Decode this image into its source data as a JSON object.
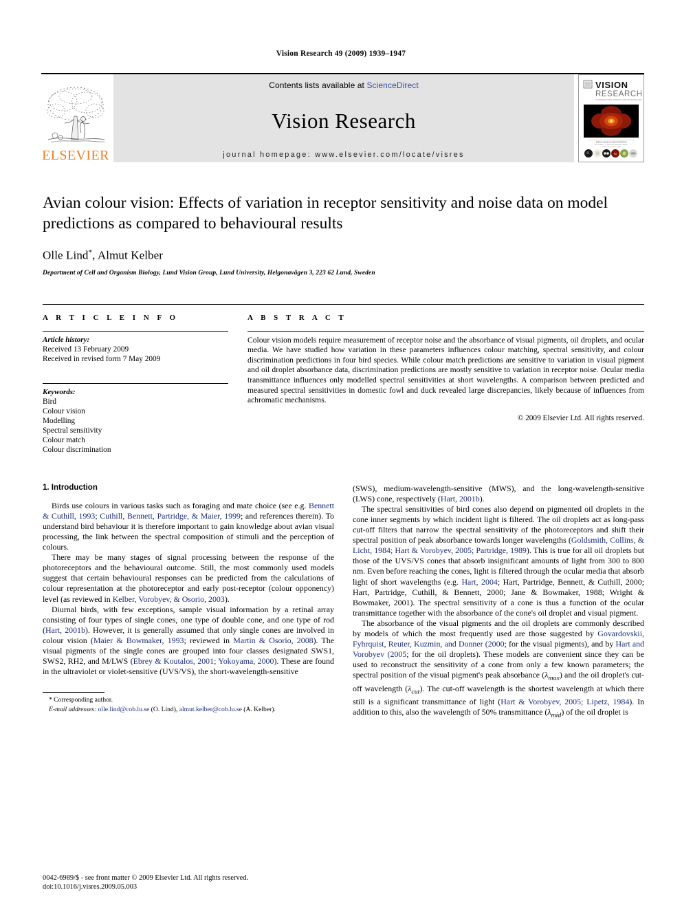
{
  "running_head": "Vision Research 49 (2009) 1939–1947",
  "masthead": {
    "publisher_name": "ELSEVIER",
    "contents_prefix": "Contents lists available at ",
    "contents_link": "ScienceDirect",
    "journal_title": "Vision Research",
    "homepage": "journal homepage: www.elsevier.com/locate/visres",
    "cover": {
      "line1": "VISION",
      "line2": "RESEARCH",
      "line3": "AN INTERNATIONAL JOURNAL FOR FUNCTIONAL ASPECTS OF VISION"
    }
  },
  "article": {
    "title": "Avian colour vision: Effects of variation in receptor sensitivity and noise data on model predictions as compared to behavioural results",
    "authors": "Olle Lind",
    "authors_rest": ", Almut Kelber",
    "corresponding_marker": "*",
    "affiliation": "Department of Cell and Organism Biology, Lund Vision Group, Lund University, Helgonavägen 3, 223 62 Lund, Sweden"
  },
  "info": {
    "heading": "A R T I C L E   I N F O",
    "history_label": "Article history:",
    "history": [
      "Received 13 February 2009",
      "Received in revised form 7 May 2009"
    ],
    "keywords_label": "Keywords:",
    "keywords": [
      "Bird",
      "Colour vision",
      "Modelling",
      "Spectral sensitivity",
      "Colour match",
      "Colour discrimination"
    ]
  },
  "abstract": {
    "heading": "A B S T R A C T",
    "text": "Colour vision models require measurement of receptor noise and the absorbance of visual pigments, oil droplets, and ocular media. We have studied how variation in these parameters influences colour matching, spectral sensitivity, and colour discrimination predictions in four bird species. While colour match predictions are sensitive to variation in visual pigment and oil droplet absorbance data, discrimination predictions are mostly sensitive to variation in receptor noise. Ocular media transmittance influences only modelled spectral sensitivities at short wavelengths. A comparison between predicted and measured spectral sensitivities in domestic fowl and duck revealed large discrepancies, likely because of influences from achromatic mechanisms.",
    "copyright": "© 2009 Elsevier Ltd. All rights reserved."
  },
  "introduction": {
    "heading": "1. Introduction",
    "left_paragraphs": [
      {
        "parts": [
          {
            "t": "Birds use colours in various tasks such as foraging and mate choice (see e.g. "
          },
          {
            "t": "Bennett & Cuthill, 1993; Cuthill, Bennett, Partridge, & Maier, 1999",
            "cite": true
          },
          {
            "t": "; and references therein). To understand bird behaviour it is therefore important to gain knowledge about avian visual processing, the link between the spectral composition of stimuli and the perception of colours."
          }
        ]
      },
      {
        "parts": [
          {
            "t": "There may be many stages of signal processing between the response of the photoreceptors and the behavioural outcome. Still, the most commonly used models suggest that certain behavioural responses can be predicted from the calculations of colour representation at the photoreceptor and early post-receptor (colour opponency) level (as reviewed in "
          },
          {
            "t": "Kelber, Vorobyev, & Osorio, 2003",
            "cite": true
          },
          {
            "t": ")."
          }
        ]
      },
      {
        "parts": [
          {
            "t": "Diurnal birds, with few exceptions, sample visual information by a retinal array consisting of four types of single cones, one type of double cone, and one type of rod ("
          },
          {
            "t": "Hart, 2001b",
            "cite": true
          },
          {
            "t": "). However, it is generally assumed that only single cones are involved in colour vision ("
          },
          {
            "t": "Maier & Bowmaker, 1993",
            "cite": true
          },
          {
            "t": "; reviewed in "
          },
          {
            "t": "Martin & Osorio, 2008",
            "cite": true
          },
          {
            "t": "). The visual pigments of the single cones are grouped into four classes designated SWS1, SWS2, RH2, and M/LWS ("
          },
          {
            "t": "Ebrey & Koutalos, 2001; Yokoyama, 2000",
            "cite": true
          },
          {
            "t": "). These are found in the ultraviolet or violet-sensitive (UVS/VS), the short-wavelength-sensitive"
          }
        ]
      }
    ],
    "right_paragraphs": [
      {
        "parts": [
          {
            "t": "(SWS), medium-wavelength-sensitive (MWS), and the long-wavelength-sensitive (LWS) cone, respectively ("
          },
          {
            "t": "Hart, 2001b",
            "cite": true
          },
          {
            "t": ")."
          }
        ],
        "noindent": true
      },
      {
        "parts": [
          {
            "t": "The spectral sensitivities of bird cones also depend on pigmented oil droplets in the cone inner segments by which incident light is filtered. The oil droplets act as long-pass cut-off filters that narrow the spectral sensitivity of the photoreceptors and shift their spectral position of peak absorbance towards longer wavelengths ("
          },
          {
            "t": "Goldsmith, Collins, & Licht, 1984; Hart & Vorobyev, 2005; Partridge, 1989",
            "cite": true
          },
          {
            "t": "). This is true for all oil droplets but those of the UVS/VS cones that absorb insignificant amounts of light from 300 to 800 nm. Even before reaching the cones, light is filtered through the ocular media that absorb light of short wavelengths (e.g. "
          },
          {
            "t": "Hart, 2004",
            "cite": true
          },
          {
            "t": "; Hart, Partridge, Bennett, & Cuthill, 2000; Hart, Partridge, Cuthill, & Bennett, 2000; Jane & Bowmaker, 1988; Wright & Bowmaker, 2001). The spectral sensitivity of a cone is thus a function of the ocular transmittance together with the absorbance of the cone's oil droplet and visual pigment."
          }
        ]
      },
      {
        "parts": [
          {
            "t": "The absorbance of the visual pigments and the oil droplets are commonly described by models of which the most frequently used are those suggested by "
          },
          {
            "t": "Govardovskii, Fyhrquist, Reuter, Kuzmin, and Donner (2000",
            "cite": true
          },
          {
            "t": "; for the visual pigments), and by "
          },
          {
            "t": "Hart and Vorobyev (2005",
            "cite": true
          },
          {
            "t": "; for the oil droplets). These models are convenient since they can be used to reconstruct the sensitivity of a cone from only a few known parameters; the spectral position of the visual pigment's peak absorbance ("
          },
          {
            "t": "λmax",
            "sub": "max",
            "italic": true
          },
          {
            "t": ") and the oil droplet's cut-off wavelength ("
          },
          {
            "t": "λcut",
            "sub": "cut",
            "italic": true
          },
          {
            "t": "). The cut-off wavelength is the shortest wavelength at which there still is a significant transmittance of light ("
          },
          {
            "t": "Hart & Vorobyev, 2005; Lipetz, 1984",
            "cite": true
          },
          {
            "t": "). In addition to this, also the wavelength of 50% transmittance ("
          },
          {
            "t": "λmid",
            "sub": "mid",
            "italic": true
          },
          {
            "t": ") of the oil droplet is"
          }
        ]
      }
    ]
  },
  "footnotes": {
    "corresponding": "* Corresponding author.",
    "email_label": "E-mail addresses:",
    "email1": "olle.lind@cob.lu.se",
    "email1_name": " (O. Lind), ",
    "email2": "almut.kelber@cob.lu.se",
    "email2_name": " (A. Kelber)."
  },
  "issn_footer": {
    "line1": "0042-6989/$ - see front matter © 2009 Elsevier Ltd. All rights reserved.",
    "line2": "doi:10.1016/j.visres.2009.05.003"
  },
  "colors": {
    "elsevier_orange": "#ef7d23",
    "citation_blue": "#1a2a7a",
    "link_blue": "#3b4ca0",
    "masthead_gray": "#e3e3e3"
  }
}
